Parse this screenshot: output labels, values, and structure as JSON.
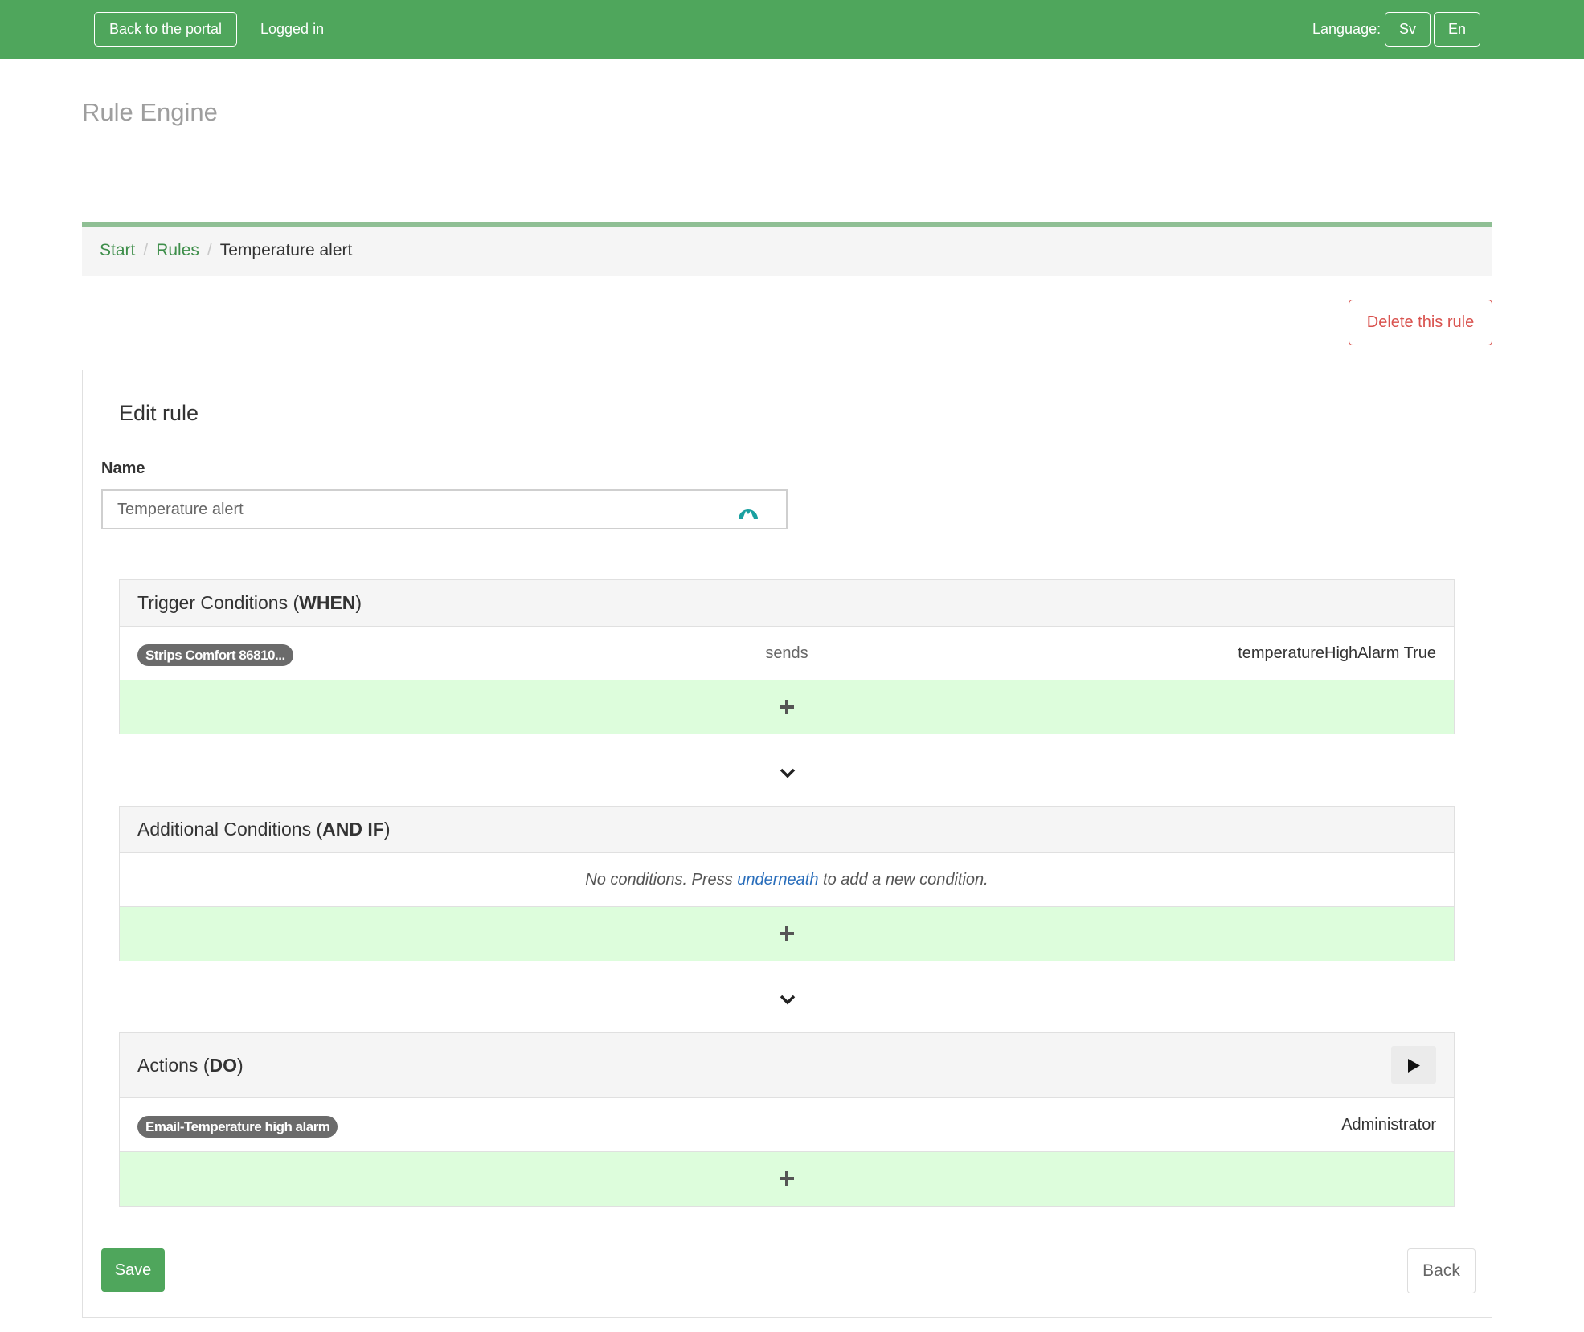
{
  "topbar": {
    "back_to_portal": "Back to the portal",
    "logged_in": "Logged in",
    "language_label": "Language:",
    "languages": [
      "Sv",
      "En"
    ]
  },
  "page": {
    "title": "Rule Engine"
  },
  "breadcrumb": {
    "items": [
      "Start",
      "Rules"
    ],
    "current": "Temperature alert"
  },
  "delete_label": "Delete this rule",
  "form": {
    "title": "Edit rule",
    "name_label": "Name",
    "name_value": "Temperature alert"
  },
  "trigger": {
    "title_prefix": "Trigger Conditions (",
    "title_bold": "WHEN",
    "title_suffix": ")",
    "row": {
      "device": "Strips Comfort 86810...",
      "verb": "sends",
      "value": "temperatureHighAlarm True"
    }
  },
  "additional": {
    "title_prefix": "Additional Conditions (",
    "title_bold": "AND IF",
    "title_suffix": ")",
    "empty_before": "No conditions. Press ",
    "empty_link": "underneath",
    "empty_after": " to add a new condition."
  },
  "actions": {
    "title_prefix": "Actions (",
    "title_bold": "DO",
    "title_suffix": ")",
    "row": {
      "action": "Email-Temperature high alarm",
      "recipient": "Administrator"
    }
  },
  "buttons": {
    "save": "Save",
    "back": "Back"
  },
  "colors": {
    "primary_green": "#4fa65c",
    "add_row_bg": "#ddfddc",
    "delete_red": "#d9534f",
    "link_blue": "#2a6ebb"
  },
  "icons": {
    "plus": "plus-icon",
    "chevron": "chevron-down-icon",
    "play": "play-icon",
    "input_extension": "password-manager-icon"
  }
}
